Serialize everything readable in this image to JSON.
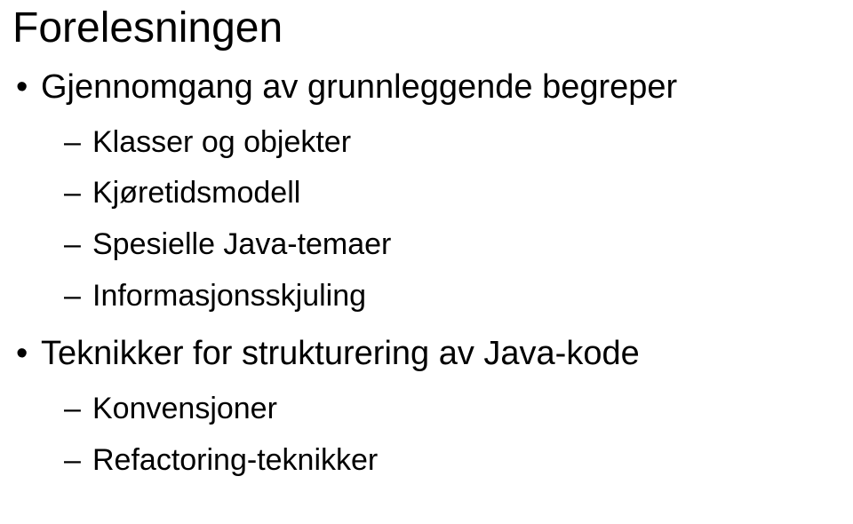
{
  "title": "Forelesningen",
  "bullets": [
    {
      "text": "Gjennomgang av grunnleggende begreper",
      "children": [
        {
          "text": "Klasser og objekter"
        },
        {
          "text": "Kjøretidsmodell"
        },
        {
          "text": "Spesielle Java-temaer"
        },
        {
          "text": "Informasjonsskjuling"
        }
      ]
    },
    {
      "text": "Teknikker for strukturering av Java-kode",
      "children": [
        {
          "text": "Konvensjoner"
        },
        {
          "text": "Refactoring-teknikker"
        }
      ]
    }
  ]
}
